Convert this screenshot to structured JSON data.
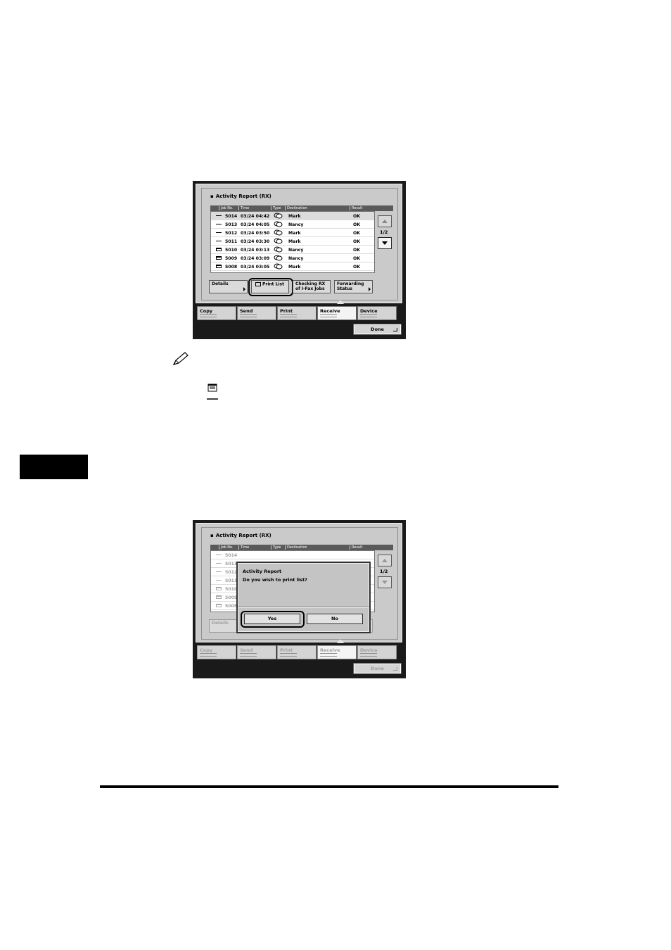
{
  "screen1": {
    "title": "Activity Report (RX)",
    "columns": [
      "Job No.",
      "Time",
      "Type",
      "Destination",
      "Result"
    ],
    "rows": [
      {
        "job": "5014",
        "time": "03/24 04:42",
        "destination": "Mark",
        "result": "OK",
        "icon": "line-icon"
      },
      {
        "job": "5013",
        "time": "03/24 04:05",
        "destination": "Nancy",
        "result": "OK",
        "icon": "line-icon"
      },
      {
        "job": "5012",
        "time": "03/24 03:50",
        "destination": "Mark",
        "result": "OK",
        "icon": "line-icon"
      },
      {
        "job": "5011",
        "time": "03/24 03:30",
        "destination": "Mark",
        "result": "OK",
        "icon": "line-icon"
      },
      {
        "job": "5010",
        "time": "03/24 03:13",
        "destination": "Nancy",
        "result": "OK",
        "icon": "document-icon"
      },
      {
        "job": "5009",
        "time": "03/24 03:09",
        "destination": "Nancy",
        "result": "OK",
        "icon": "document-icon"
      },
      {
        "job": "5008",
        "time": "03/24 03:05",
        "destination": "Mark",
        "result": "OK",
        "icon": "document-icon"
      }
    ],
    "page_indicator": "1/2",
    "buttons": {
      "details": "Details",
      "print_list": "Print List",
      "checking_rx_1": "Checking RX",
      "checking_rx_2": "of I-Fax Jobs",
      "forwarding_1": "Forwarding",
      "forwarding_2": "Status"
    },
    "tabs": [
      "Copy",
      "Send",
      "Print",
      "Receive",
      "Device"
    ],
    "active_tab": "Receive",
    "done": "Done"
  },
  "screen2": {
    "title": "Activity Report (RX)",
    "columns": [
      "Job No.",
      "Time",
      "Type",
      "Destination",
      "Result"
    ],
    "partial_rows": [
      "5014",
      "5013",
      "5012",
      "5011",
      "5010",
      "5009",
      "5008"
    ],
    "page_indicator": "1/2",
    "details": "Details",
    "tabs": [
      "Copy",
      "Send",
      "Print",
      "Receive",
      "Device"
    ],
    "done": "Done",
    "dialog": {
      "title": "Activity Report",
      "message": "Do you wish to print list?",
      "yes": "Yes",
      "no": "No"
    }
  }
}
